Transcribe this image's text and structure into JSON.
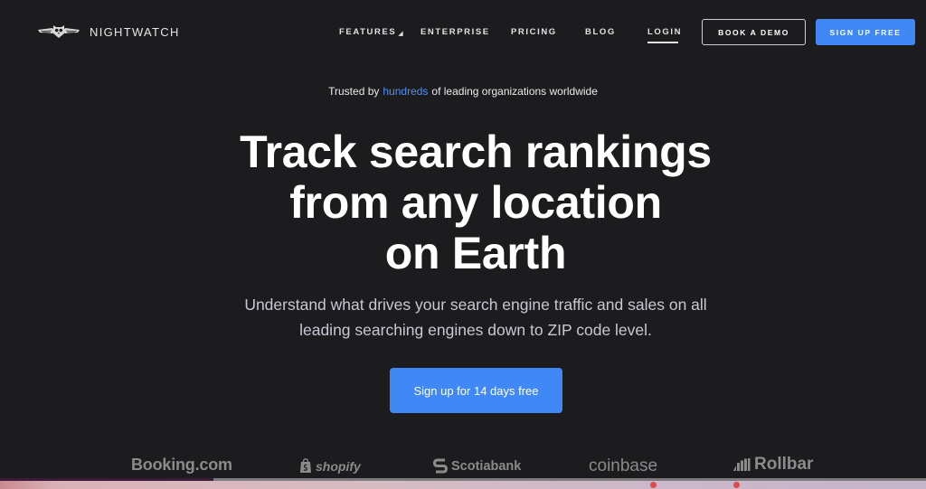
{
  "nav": {
    "logo_text": "NIGHTWATCH",
    "links": [
      {
        "label": "FEATURES",
        "has_dropdown": true
      },
      {
        "label": "ENTERPRISE"
      },
      {
        "label": "PRICING"
      },
      {
        "label": "BLOG"
      },
      {
        "label": "LOGIN",
        "active": true
      }
    ],
    "book_demo_label": "BOOK A DEMO",
    "signup_label": "SIGN UP FREE",
    "dropdown_caret": "◢"
  },
  "hero": {
    "trusted_prefix": "Trusted by",
    "trusted_highlight": "hundreds",
    "trusted_suffix": "of leading organizations worldwide",
    "headline_lines": [
      "Track search rankings",
      "from any location",
      "on Earth"
    ],
    "subhead_lines": [
      "Understand what drives your search engine traffic and sales on all",
      "leading searching engines down to ZIP code level."
    ],
    "cta_label": "Sign up for 14 days free"
  },
  "logos": [
    {
      "name": "Booking.com",
      "icon": "none"
    },
    {
      "name": "shopify",
      "icon": "shopping-bag-icon"
    },
    {
      "name": "Scotiabank",
      "icon": "scotiabank-s-icon"
    },
    {
      "name": "coinbase",
      "icon": "none"
    },
    {
      "name": "Rollbar",
      "icon": "rollbar-bars-icon"
    }
  ],
  "bottom_bar": {
    "progress": 0.23
  },
  "colors": {
    "background": "#1c1c1e",
    "accent": "#3f88f6",
    "highlight_text": "#4f8ff7",
    "logo_gray": "#8b8b8b"
  }
}
